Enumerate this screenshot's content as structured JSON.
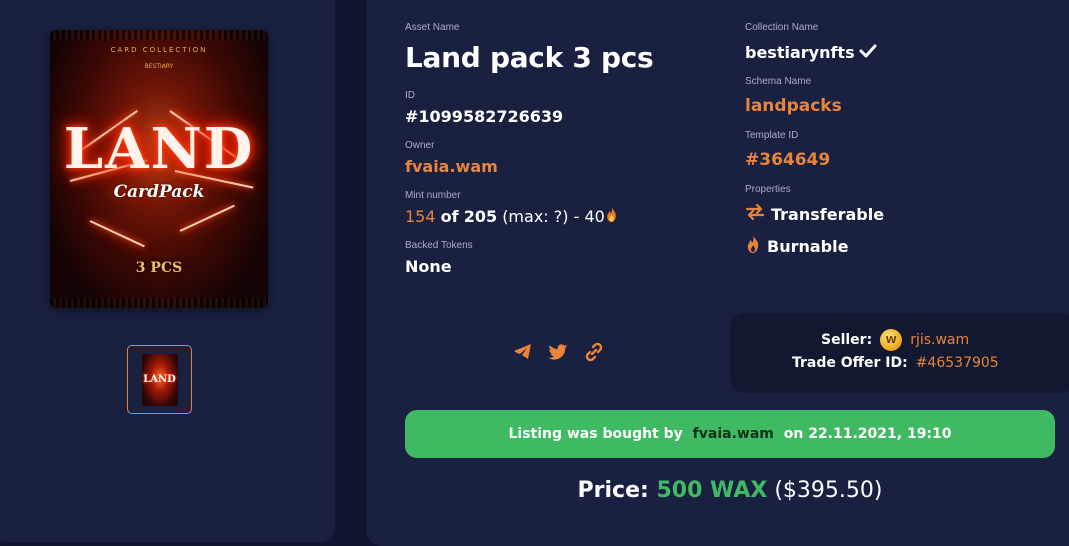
{
  "media": {
    "pack_caption": "CARD COLLECTION",
    "pack_subcaption": "BESTIARY",
    "pack_title": "LAND",
    "pack_subtitle": "CardPack",
    "pack_count": "3 PCS",
    "thumb_text": "LAND"
  },
  "asset": {
    "name_label": "Asset Name",
    "name": "Land pack 3 pcs",
    "id_label": "ID",
    "id": "#1099582726639",
    "owner_label": "Owner",
    "owner": "fvaia.wam",
    "mint_label": "Mint number",
    "mint_number": "154",
    "mint_of": "of",
    "mint_total": "205",
    "mint_max": "(max: ?) - 40",
    "backed_label": "Backed Tokens",
    "backed": "None"
  },
  "collection": {
    "collection_label": "Collection Name",
    "collection": "bestiarynfts",
    "schema_label": "Schema Name",
    "schema": "landpacks",
    "template_label": "Template ID",
    "template": "#364649",
    "properties_label": "Properties",
    "prop_transferable": "Transferable",
    "prop_burnable": "Burnable"
  },
  "seller": {
    "seller_label": "Seller:",
    "seller": "rjis.wam",
    "coin_letter": "W",
    "offer_label": "Trade Offer ID:",
    "offer_id": "#46537905"
  },
  "status": {
    "prefix": "Listing was bought by ",
    "buyer": "fvaia.wam",
    "suffix": " on 22.11.2021, 19:10"
  },
  "price": {
    "label": "Price: ",
    "amount": "500 WAX",
    "usd": "($395.50)"
  },
  "colors": {
    "background": "#101631",
    "panel": "#1a2040",
    "accent_orange": "#e8853a",
    "accent_green": "#3fba63"
  }
}
